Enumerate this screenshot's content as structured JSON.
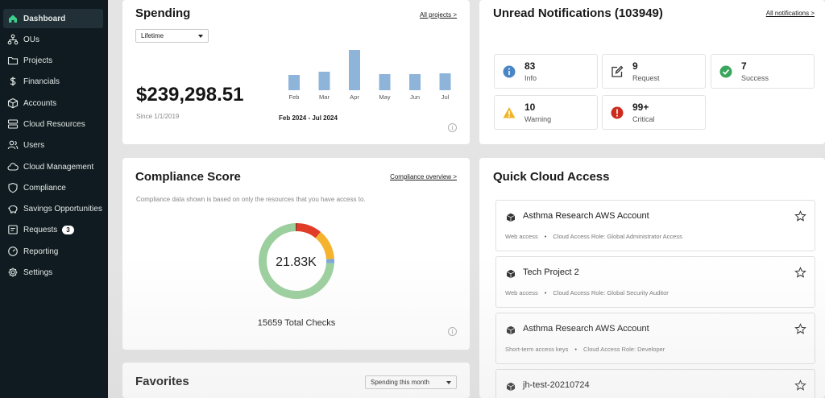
{
  "sidebar": {
    "items": [
      {
        "label": "Dashboard",
        "icon": "home-icon",
        "active": true
      },
      {
        "label": "OUs",
        "icon": "org-tree-icon"
      },
      {
        "label": "Projects",
        "icon": "folder-icon"
      },
      {
        "label": "Financials",
        "icon": "dollar-icon"
      },
      {
        "label": "Accounts",
        "icon": "cube-icon"
      },
      {
        "label": "Cloud Resources",
        "icon": "server-icon"
      },
      {
        "label": "Users",
        "icon": "users-icon"
      },
      {
        "label": "Cloud Management",
        "icon": "cloud-icon"
      },
      {
        "label": "Compliance",
        "icon": "shield-icon"
      },
      {
        "label": "Savings Opportunities",
        "icon": "piggy-bank-icon"
      },
      {
        "label": "Requests",
        "icon": "inbox-icon",
        "badge": "3"
      },
      {
        "label": "Reporting",
        "icon": "gauge-icon"
      },
      {
        "label": "Settings",
        "icon": "gear-icon"
      }
    ]
  },
  "spending": {
    "title": "Spending",
    "link": "All projects >",
    "filter": "Lifetime",
    "amount": "$239,298.51",
    "since": "Since 1/1/2019",
    "period": "Feb 2024 - Jul 2024",
    "bar_color": "#8fb4da"
  },
  "chart_data": {
    "type": "bar",
    "categories": [
      "Feb",
      "Mar",
      "Apr",
      "May",
      "Jun",
      "Jul"
    ],
    "values": [
      19,
      23,
      50,
      20,
      20,
      21
    ],
    "xlabel": "",
    "ylabel": "",
    "ylim": [
      0,
      50
    ],
    "grid": false
  },
  "notifications": {
    "title": "Unread Notifications (103949)",
    "link": "All notifications >",
    "items": [
      {
        "count": "83",
        "label": "Info",
        "icon": "info-icon",
        "color": "#4a86c5"
      },
      {
        "count": "9",
        "label": "Request",
        "icon": "request-icon",
        "color": "#333333"
      },
      {
        "count": "7",
        "label": "Success",
        "icon": "check-circle-icon",
        "color": "#3aa55c"
      },
      {
        "count": "10",
        "label": "Warning",
        "icon": "warning-icon",
        "color": "#f0b429"
      },
      {
        "count": "99+",
        "label": "Critical",
        "icon": "critical-icon",
        "color": "#cc2b1d"
      }
    ]
  },
  "compliance": {
    "title": "Compliance Score",
    "link": "Compliance overview >",
    "description": "Compliance data shown is based on only the resources that you have access to.",
    "score": "21.83K",
    "total_checks": "15659 Total Checks",
    "segments": [
      {
        "fraction": 0.11,
        "color": "#e03c27"
      },
      {
        "fraction": 0.13,
        "color": "#f5b22d"
      },
      {
        "fraction": 0.02,
        "color": "#7fa8d8"
      },
      {
        "fraction": 0.735,
        "color": "#9ccf9e"
      },
      {
        "fraction": 0.005,
        "color": "#5a1a12"
      }
    ]
  },
  "quick_access": {
    "title": "Quick Cloud Access",
    "items": [
      {
        "name": "Asthma Research AWS Account",
        "access": "Web access",
        "role": "Cloud Access Role: Global Administrator Access"
      },
      {
        "name": "Tech Project 2",
        "access": "Web access",
        "role": "Cloud Access Role: Global Security Auditor"
      },
      {
        "name": "Asthma Research AWS Account",
        "access": "Short-term access keys",
        "role": "Cloud Access Role: Developer"
      },
      {
        "name": "jh-test-20210724",
        "access": "",
        "role": ""
      }
    ]
  },
  "favorites": {
    "title": "Favorites",
    "filter": "Spending this month"
  }
}
